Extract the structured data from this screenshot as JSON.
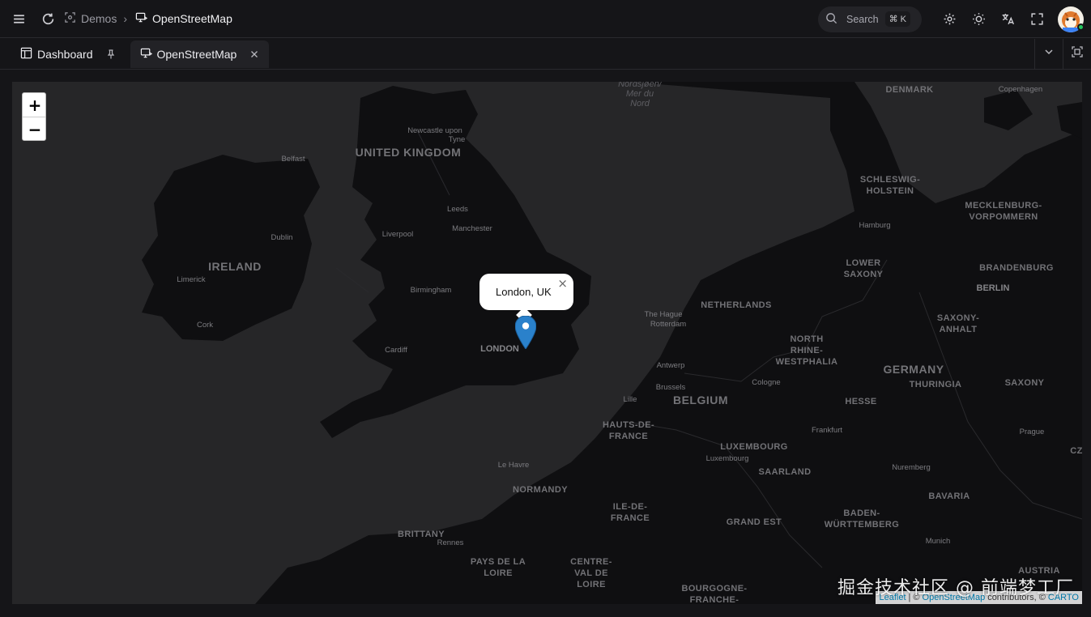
{
  "header": {
    "breadcrumb": [
      {
        "label": "Demos",
        "icon": "demos-icon"
      },
      {
        "label": "OpenStreetMap",
        "icon": "monitor-icon"
      }
    ],
    "search": {
      "label": "Search",
      "shortcut": "⌘ K"
    }
  },
  "tabs": [
    {
      "label": "Dashboard",
      "icon": "dashboard-icon",
      "pinned": true
    },
    {
      "label": "OpenStreetMap",
      "icon": "monitor-icon",
      "active": true
    }
  ],
  "map": {
    "zoom_in": "+",
    "zoom_out": "−",
    "popup": {
      "text": "London, UK",
      "close": "×"
    },
    "labels": {
      "sea": [
        "Nordsjøen/",
        "Mer du",
        "Nord"
      ],
      "countries": [
        "UNITED KINGDOM",
        "IRELAND",
        "NETHERLANDS",
        "BELGIUM",
        "GERMANY",
        "DENMARK"
      ],
      "regions": [
        "SCHLESWIG-",
        "HOLSTEIN",
        "MECKLENBURG-",
        "VORPOMMERN",
        "LOWER",
        "SAXONY",
        "BRANDENBURG",
        "SAXONY-",
        "ANHALT",
        "NORTH",
        "RHINE-",
        "WESTPHALIA",
        "HESSE",
        "THURINGIA",
        "SAXONY",
        "LUXEMBOURG",
        "SAARLAND",
        "HAUTS-DE-",
        "FRANCE",
        "NORMANDY",
        "ILE-DE-",
        "FRANCE",
        "GRAND EST",
        "BADEN-",
        "WÜRTTEMBERG",
        "BAVARIA",
        "BRITTANY",
        "PAYS DE LA",
        "LOIRE",
        "CENTRE-",
        "VAL DE",
        "LOIRE",
        "BOURGOGNE-",
        "FRANCHE-",
        "AUSTRIA",
        "CZ"
      ],
      "cities": [
        "Newcastle upon",
        "Tyne",
        "Belfast",
        "Leeds",
        "Liverpool",
        "Manchester",
        "Dublin",
        "Birmingham",
        "Limerick",
        "Cork",
        "Cardiff",
        "LONDON",
        "The Hague",
        "Rotterdam",
        "Antwerp",
        "Brussels",
        "Lille",
        "Cologne",
        "Frankfurt",
        "Luxembourg",
        "Le Havre",
        "Rennes",
        "Nuremberg",
        "Munich",
        "Prague",
        "Hamburg",
        "BERLIN",
        "Copenhagen"
      ]
    },
    "attribution": {
      "leaflet": "Leaflet",
      "sep": "| ©",
      "osm": "OpenStreetMap",
      "contributors": "contributors, ©",
      "carto": "CARTO"
    },
    "watermark": "掘金技术社区 @ 前端梦工厂"
  }
}
